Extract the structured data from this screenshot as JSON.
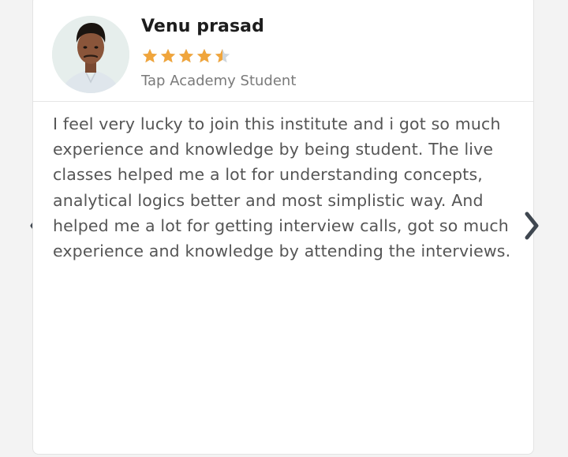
{
  "testimonial": {
    "name": "Venu prasad",
    "role": "Tap Academy Student",
    "rating": 4.5,
    "rating_max": 5,
    "review": "I feel very lucky to join this institute and i got so much experience and knowledge by being student. The live classes helped me a lot for understanding concepts, analytical logics better and most simplistic way. And helped me a lot for getting interview calls, got so much experience and knowledge by attending the interviews."
  },
  "icons": {
    "prev": "chevron-left-icon",
    "next": "chevron-right-icon",
    "star": "star-icon"
  },
  "colors": {
    "star_filled": "#f0a53c",
    "star_empty": "#cfd6dc",
    "nav_arrow": "#3f4750"
  }
}
